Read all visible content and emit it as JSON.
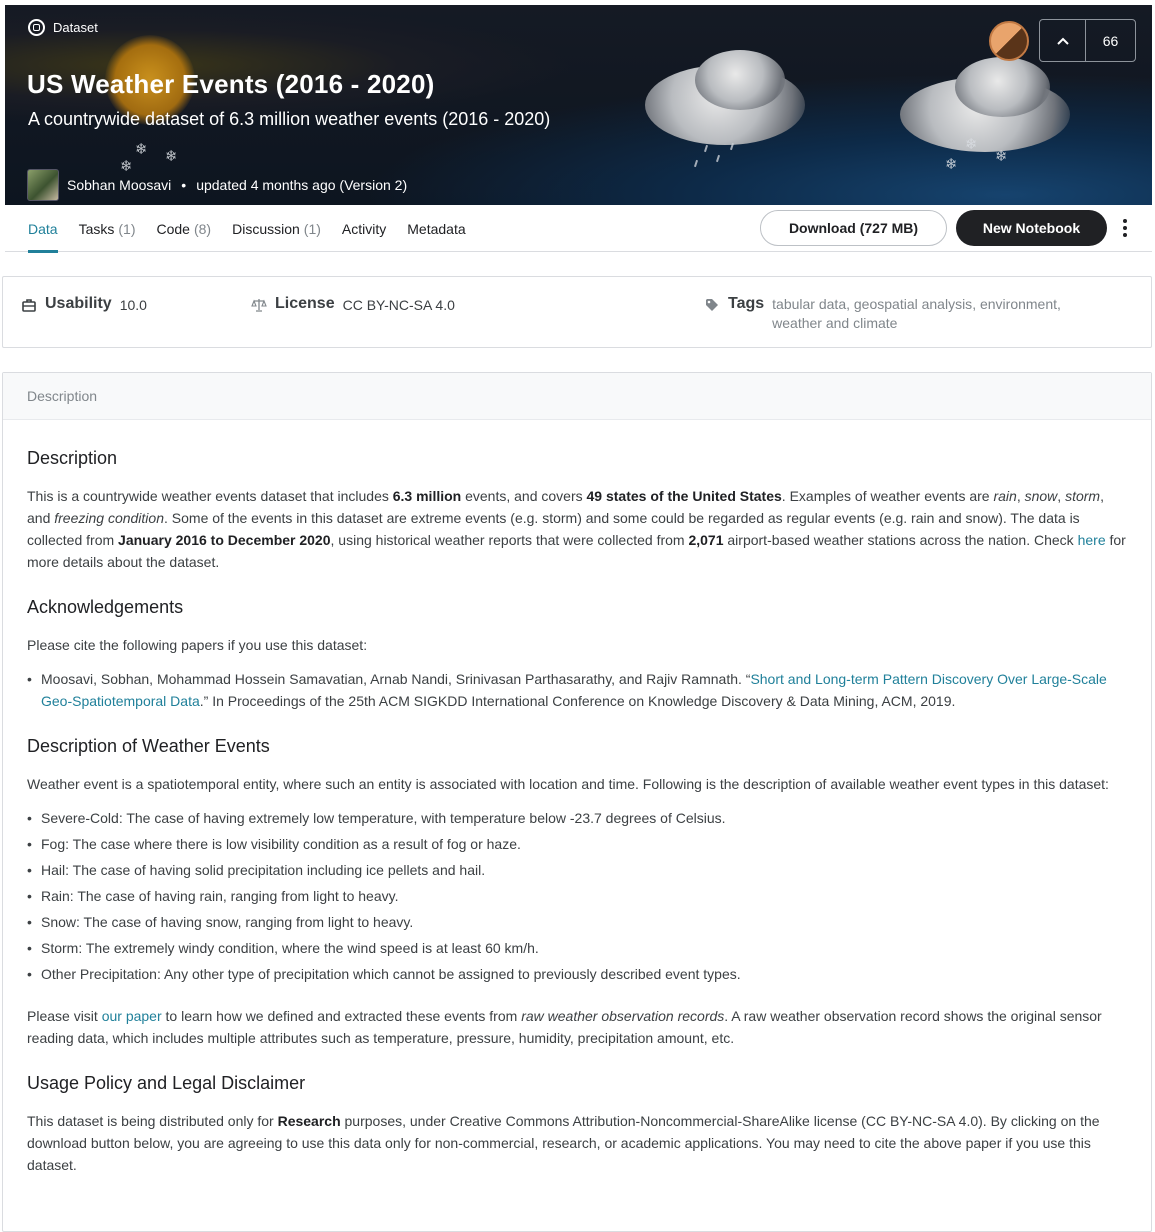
{
  "hero": {
    "type_label": "Dataset",
    "title": "US Weather Events (2016 - 2020)",
    "subtitle": "A countrywide dataset of 6.3 million weather events (2016 - 2020)",
    "author": "Sobhan Moosavi",
    "updated": "updated 4 months ago (Version 2)",
    "vote_count": "66"
  },
  "tabs": [
    {
      "label": "Data",
      "count": ""
    },
    {
      "label": "Tasks",
      "count": "(1)"
    },
    {
      "label": "Code",
      "count": "(8)"
    },
    {
      "label": "Discussion",
      "count": "(1)"
    },
    {
      "label": "Activity",
      "count": ""
    },
    {
      "label": "Metadata",
      "count": ""
    }
  ],
  "actions": {
    "download": "Download (727 MB)",
    "new_notebook": "New Notebook"
  },
  "meta": {
    "usability_label": "Usability",
    "usability_value": "10.0",
    "license_label": "License",
    "license_value": "CC BY-NC-SA 4.0",
    "tags_label": "Tags",
    "tags": [
      "tabular data",
      "geospatial analysis",
      "environment",
      "weather and climate"
    ]
  },
  "description": {
    "card_title": "Description",
    "s1_title": "Description",
    "s1_p": {
      "a": "This is a countrywide weather events dataset that includes ",
      "b1": "6.3 million",
      "c": " events, and covers ",
      "b2": "49 states of the United States",
      "d": ". Examples of weather events are ",
      "i1": "rain",
      "e": ", ",
      "i2": "snow",
      "f": ", ",
      "i3": "storm",
      "g": ", and ",
      "i4": "freezing condition",
      "h": ". Some of the events in this dataset are extreme events (e.g. storm) and some could be regarded as regular events (e.g. rain and snow). The data is collected from ",
      "b3": "January 2016 to December 2020",
      "j": ", using historical weather reports that were collected from ",
      "b4": "2,071",
      "k": " airport-based weather stations across the nation. Check ",
      "link": "here",
      "l": " for more details about the dataset."
    },
    "s2_title": "Acknowledgements",
    "s2_intro": "Please cite the following papers if you use this dataset:",
    "s2_cite": {
      "a": "Moosavi, Sobhan, Mohammad Hossein Samavatian, Arnab Nandi, Srinivasan Parthasarathy, and Rajiv Ramnath. “",
      "link": "Short and Long-term Pattern Discovery Over Large-Scale Geo-Spatiotemporal Data",
      "b": ".” In Proceedings of the 25th ACM SIGKDD International Conference on Knowledge Discovery & Data Mining, ACM, 2019."
    },
    "s3_title": "Description of Weather Events",
    "s3_intro": "Weather event is a spatiotemporal entity, where such an entity is associated with location and time. Following is the description of available weather event types in this dataset:",
    "s3_items": [
      "Severe-Cold: The case of having extremely low temperature, with temperature below -23.7 degrees of Celsius.",
      "Fog: The case where there is low visibility condition as a result of fog or haze.",
      "Hail: The case of having solid precipitation including ice pellets and hail.",
      "Rain: The case of having rain, ranging from light to heavy.",
      "Snow: The case of having snow, ranging from light to heavy.",
      "Storm: The extremely windy condition, where the wind speed is at least 60 km/h.",
      "Other Precipitation: Any other type of precipitation which cannot be assigned to previously described event types."
    ],
    "s3_outro": {
      "a": "Please visit ",
      "link": "our paper",
      "b": " to learn how we defined and extracted these events from ",
      "i": "raw weather observation records",
      "c": ". A raw weather observation record shows the original sensor reading data, which includes multiple attributes such as temperature, pressure, humidity, precipitation amount, etc."
    },
    "s4_title": "Usage Policy and Legal Disclaimer",
    "s4_p": {
      "a": "This dataset is being distributed only for ",
      "b": "Research",
      "c": " purposes, under Creative Commons Attribution-Noncommercial-ShareAlike license (CC BY-NC-SA 4.0). By clicking on the download button below, you are agreeing to use this data only for non-commercial, research, or academic applications. You may need to cite the above paper if you use this dataset."
    }
  },
  "colors": {
    "accent": "#20809a",
    "dark_button": "#202124"
  }
}
